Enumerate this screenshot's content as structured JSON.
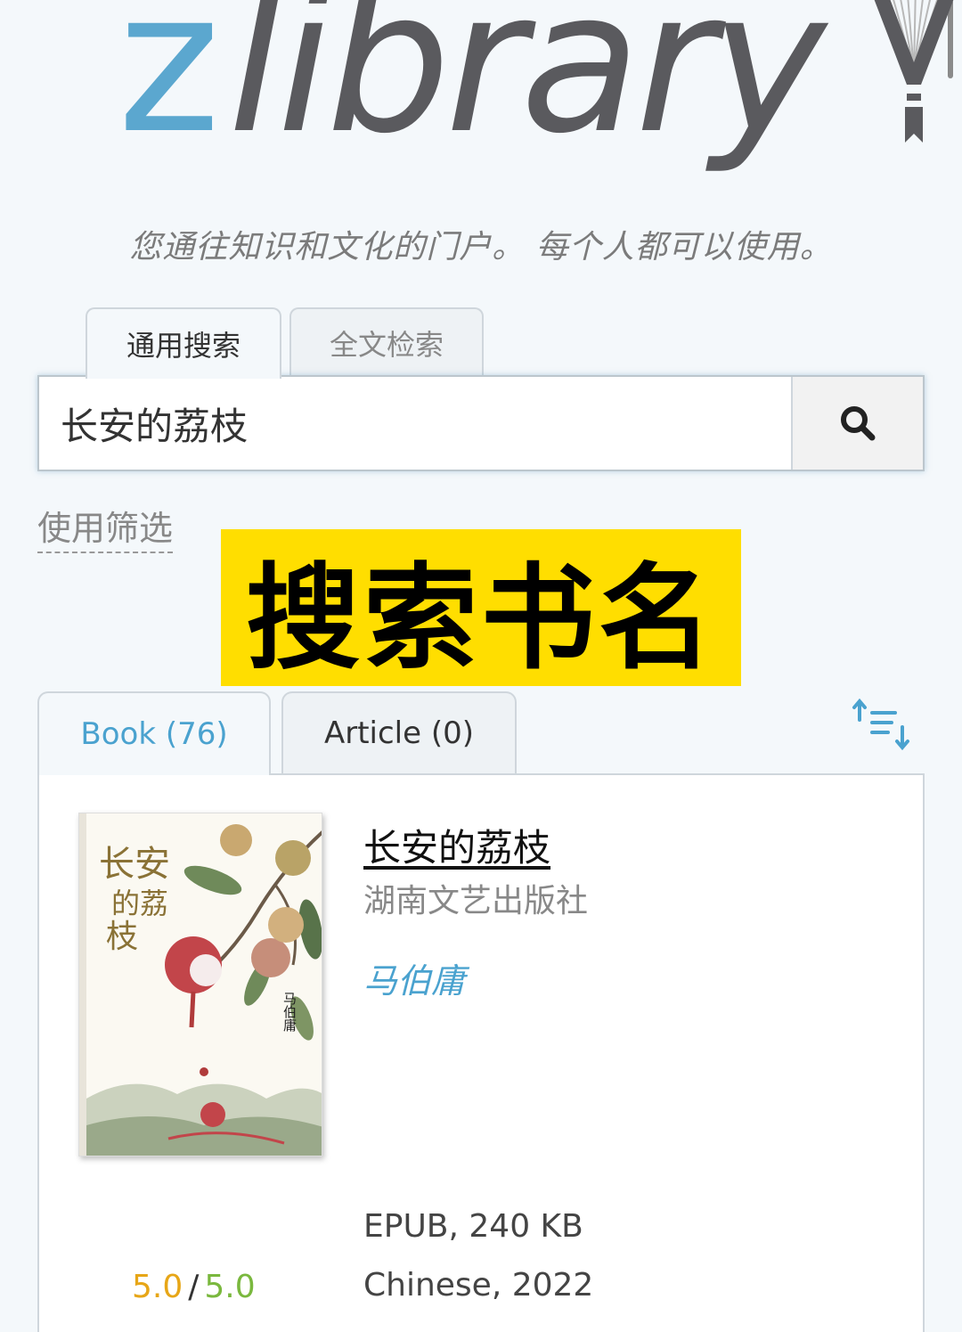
{
  "logo": {
    "z": "z",
    "rest": "library"
  },
  "tagline": "您通往知识和文化的门户。 每个人都可以使用。",
  "search_tabs": [
    {
      "label": "通用搜索",
      "active": true
    },
    {
      "label": "全文检索",
      "active": false
    }
  ],
  "search": {
    "value": "长安的荔枝",
    "button_icon": "search-icon"
  },
  "filter_link": "使用筛选",
  "overlay_banner": "搜索书名",
  "result_tabs": [
    {
      "label": "Book (76)",
      "active": true
    },
    {
      "label": "Article (0)",
      "active": false
    }
  ],
  "sort_icon": "sort-order-icon",
  "result": {
    "title": "长安的荔枝",
    "publisher": "湖南文艺出版社",
    "author": "马伯庸",
    "format": "EPUB, 240 KB",
    "language_year": "Chinese, 2022",
    "rating": {
      "score": "5.0",
      "separator": "/",
      "quality": "5.0"
    },
    "cover": {
      "title_text": "长安的荔枝",
      "author_text": "马伯庸"
    }
  },
  "colors": {
    "accent_blue": "#4aa2cf",
    "logo_blue": "#5ba7cf",
    "logo_gray": "#5a5a5e",
    "banner_yellow": "#ffde00",
    "rating_orange": "#e7a617",
    "rating_green": "#7ab83e"
  }
}
